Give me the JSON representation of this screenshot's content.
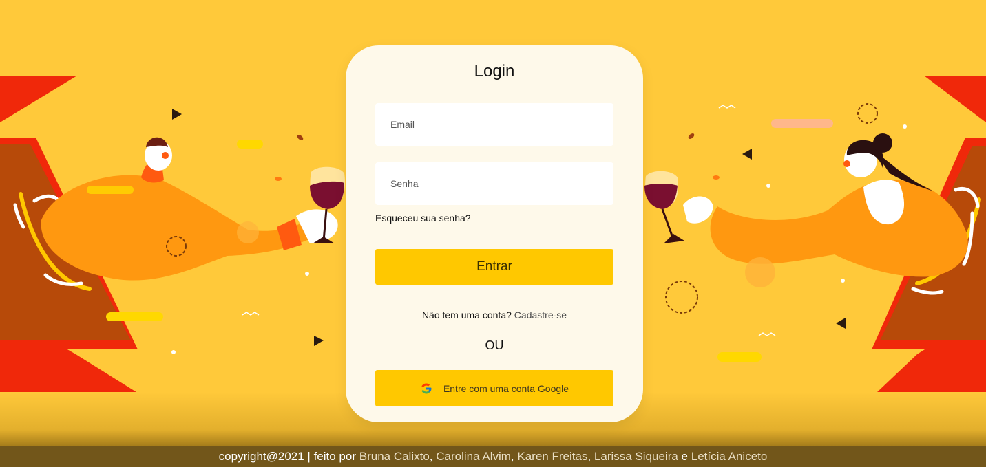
{
  "colors": {
    "background": "#ffc93a",
    "card": "#fef9ea",
    "accent_button": "#ffc800",
    "footer": "#72561a"
  },
  "login": {
    "title": "Login",
    "email_placeholder": "Email",
    "password_placeholder": "Senha",
    "forgot_label": "Esqueceu sua senha?",
    "submit_label": "Entrar",
    "signup_prompt": "Não tem uma conta?",
    "signup_link": "Cadastre-se",
    "or_label": "OU",
    "google_label": "Entre com uma conta Google",
    "google_icon": "google-g-icon"
  },
  "illustration": {
    "left": "man-toasting-wine-illustration",
    "right": "woman-toasting-wine-illustration"
  },
  "footer": {
    "prefix": "copyright@2021 | feito por",
    "authors": [
      "Bruna Calixto",
      "Carolina Alvim",
      "Karen Freitas",
      "Larissa Siqueira",
      "Letícia Aniceto"
    ],
    "sep1": ",",
    "sep2": ",",
    "sep3": ",",
    "conj": "e"
  }
}
